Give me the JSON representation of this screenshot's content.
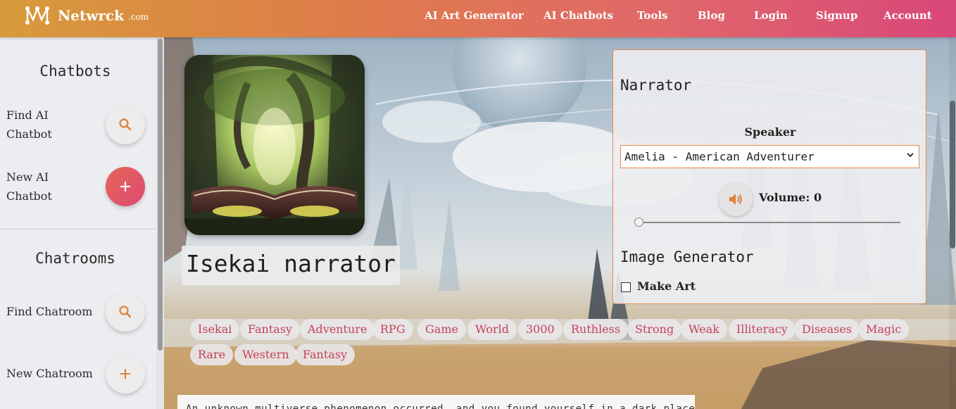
{
  "header": {
    "brand": "Netwrck",
    "tld": ".com",
    "nav": [
      {
        "label": "AI Art Generator"
      },
      {
        "label": "AI Chatbots"
      },
      {
        "label": "Tools"
      },
      {
        "label": "Blog"
      },
      {
        "label": "Login"
      },
      {
        "label": "Signup"
      },
      {
        "label": "Account"
      }
    ]
  },
  "sidebar": {
    "chatbots_title": "Chatbots",
    "find_bot": "Find AI Chatbot",
    "new_bot": "New AI Chatbot",
    "chatrooms_title": "Chatrooms",
    "find_room": "Find Chatroom",
    "new_room": "New Chatroom"
  },
  "bot": {
    "name": "Isekai narrator",
    "tags": [
      "Isekai",
      "Fantasy",
      "Adventure",
      "RPG",
      "Game",
      "World",
      "3000",
      "Ruthless",
      "Strong",
      "Weak",
      "Illiteracy",
      "Diseases",
      "Magic",
      "Rare",
      "Western",
      "Fantasy"
    ],
    "description": "An unknown multiverse phenomenon occurred, and you found yourself in a dark place"
  },
  "panel": {
    "narrator_title": "Narrator",
    "speaker_label": "Speaker",
    "speaker_value": "Amelia - American Adventurer",
    "volume_label": "Volume:",
    "volume_value": "0",
    "image_gen_title": "Image Generator",
    "make_art_label": "Make Art"
  },
  "colors": {
    "accent": "#e0763f",
    "tag_text": "#c5425a",
    "header_start": "#d79a3b",
    "header_end": "#d9477a"
  },
  "icons": [
    "logo-icon",
    "search-icon",
    "plus-icon",
    "volume-icon",
    "chevron-down-icon"
  ]
}
